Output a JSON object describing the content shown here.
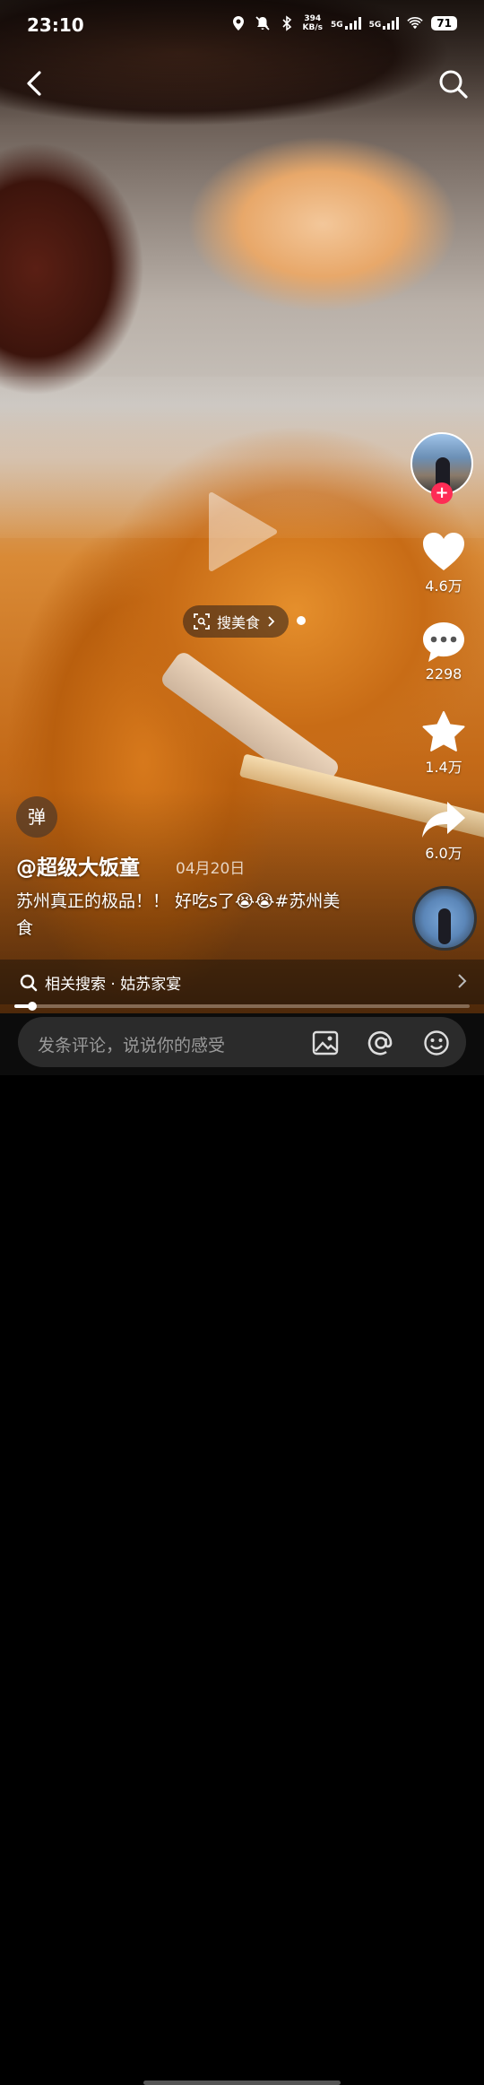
{
  "status_bar": {
    "time": "23:10",
    "net_speed_value": "394",
    "net_speed_unit": "KB/s",
    "signal_1": "5G",
    "signal_2": "5G",
    "battery": "71"
  },
  "header": {
    "back_icon": "chevron-left-icon",
    "search_icon": "search-icon"
  },
  "overlay": {
    "search_food_label": "搜美食"
  },
  "rail": {
    "like_count": "4.6万",
    "comment_count": "2298",
    "favorite_count": "1.4万",
    "share_count": "6.0万",
    "follow_plus": "+"
  },
  "post": {
    "danmu_label": "弹",
    "author": "@超级大饭童",
    "date": "04月20日",
    "caption": "苏州真正的极品！！ 好吃s了😭😭#苏州美食"
  },
  "related_search": {
    "label": "相关搜索 · 姑苏家宴"
  },
  "playback": {
    "progress_fraction": 0.04
  },
  "comment_bar": {
    "placeholder": "发条评论，说说你的感受"
  },
  "colors": {
    "accent": "#fe2c55",
    "input_bg": "#2b2b2b"
  }
}
